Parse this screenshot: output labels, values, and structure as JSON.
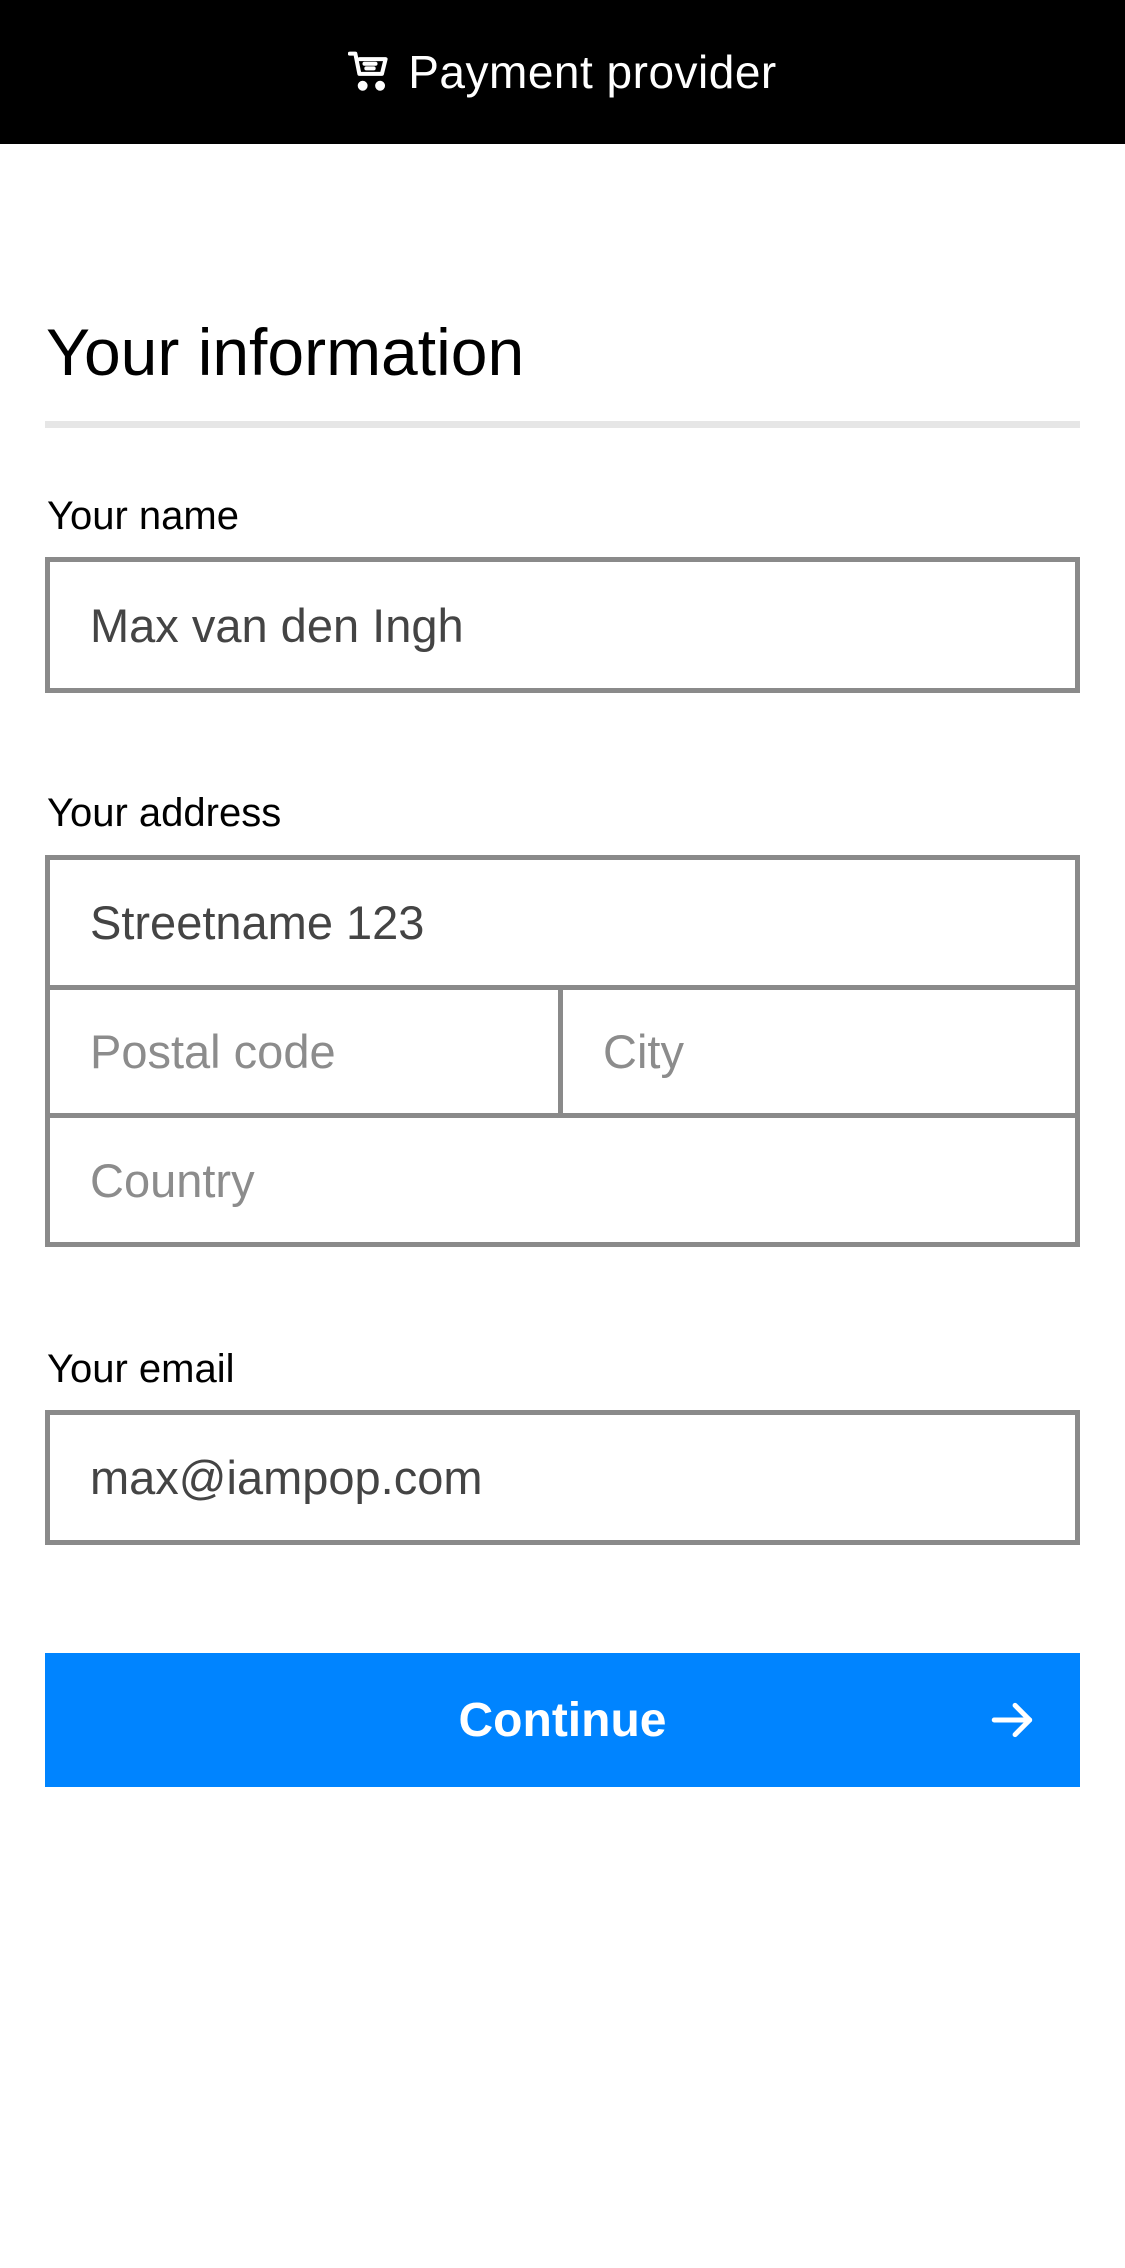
{
  "header": {
    "title": "Payment provider",
    "icon": "shopping-cart-icon"
  },
  "form": {
    "heading": "Your information",
    "name": {
      "label": "Your name",
      "value": "Max van den Ingh"
    },
    "address": {
      "label": "Your address",
      "street_value": "Streetname 123",
      "postal_placeholder": "Postal code",
      "city_placeholder": "City",
      "country_placeholder": "Country"
    },
    "email": {
      "label": "Your email",
      "value": "max@iampop.com"
    },
    "submit": {
      "label": "Continue",
      "icon": "arrow-right-icon",
      "color": "#0084ff"
    }
  },
  "colors": {
    "header_bg": "#000000",
    "field_border": "#8a8a8a",
    "divider": "#e6e6e6"
  }
}
